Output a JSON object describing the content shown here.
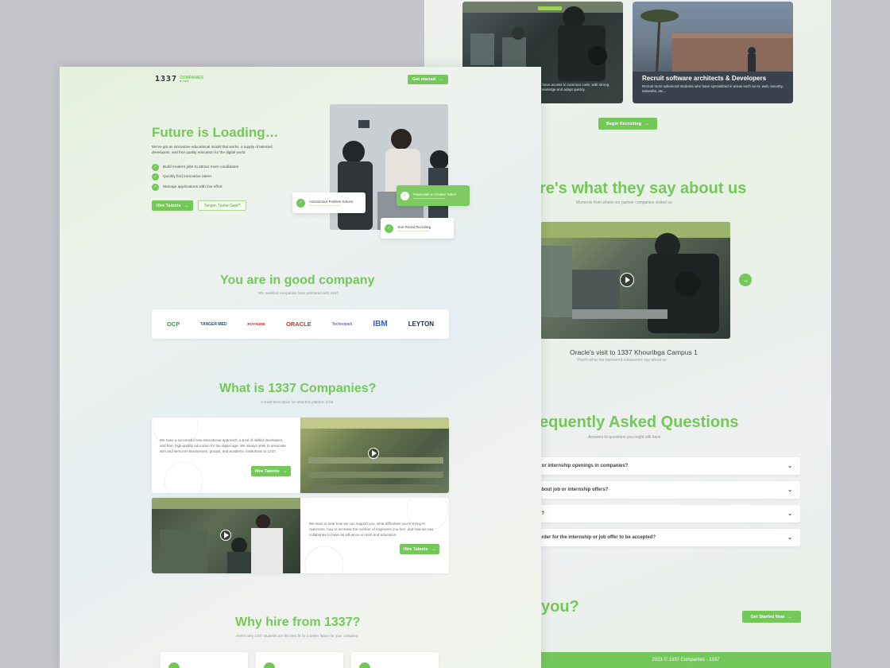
{
  "back": {
    "card_recruit_dev_sub": "…have access to common code, with strong knowledge and adapt quickly.",
    "card_recruit_arch_title": "Recruit software architects & Developers",
    "card_recruit_arch_sub": "Recruit more advanced students who have specialized in areas such as AI, web, security, networks, etc...",
    "begin_recruiting": "Begin Recruiting",
    "testimonials_title": "re's what they say about us",
    "testimonials_sub": "Moments from where our partner companies visited us",
    "video_caption": "Oracle's visit to 1337 Khouribga Campus 1",
    "video_sub": "Watch what our partnered companies say about us",
    "faq_title": "equently Asked Questions",
    "faq_sub": "Answers to questions you might still have",
    "faq_items": [
      "t or internship openings in companies?",
      "about job or internship offers?",
      "e?",
      "order for the internship or job offer to be accepted?"
    ],
    "cta_title": "you?",
    "get_started_now": "Get Started Now",
    "footer": "2023 © 1337 Companies - 1337"
  },
  "front": {
    "logo_num": "1337",
    "logo_top": "COMPANIES",
    "logo_bottom": "BY 1337",
    "get_started": "Get started",
    "hero_title": "Future is Loading…",
    "hero_desc": "We've got an innovative educational model that works, a supply of talented developers, and free quality education for the digital world.",
    "checklist": [
      "Build modern jobs to attract more candidates",
      "Quickly find innovative talent",
      "Manage applications with low effort"
    ],
    "hire_talents": "Hire Talents",
    "tanger": "Tanger, Tanke-Sept?",
    "float_autonomous": "Autonomous Problem Solvers",
    "float_passionate": "Passionate & Creative Talent",
    "float_recruiting": "Year-Round Recruiting",
    "good_company_title": "You are in good company",
    "good_company_sub": "50+ satisfied companies have partnered with 1337",
    "partners": [
      {
        "name": "OCP",
        "color": "#3d9a3a"
      },
      {
        "name": "TANGER MED",
        "color": "#1a4f8c"
      },
      {
        "name": "ROYAUME",
        "color": "#c32a2a"
      },
      {
        "name": "ORACLE",
        "color": "#d6302a"
      },
      {
        "name": "Technopark",
        "color": "#2d3f8f"
      },
      {
        "name": "IBM",
        "color": "#3560b8"
      },
      {
        "name": "LEYTON",
        "color": "#1e2b5c"
      }
    ],
    "what_title": "What is 1337 Companies?",
    "what_sub": "A small description for what this platform is for",
    "what_text_1": "We have a successful new educational approach, a pool of skilled developers, and free, high-quality education for the digital age. We always seek to associate with and welcome Businesses, groups, and academic institutions to 1337.",
    "what_text_2": "We want to hear how we can support you, what difficulties you're trying to overcome, how to increase the number of engineers you hire, and how we can collaborate to have an influence on tech and education.",
    "why_title": "Why hire from 1337?",
    "why_sub": "Here's why 1337 students are the best fit for a better future for your company"
  },
  "colors": {
    "accent": "#74c85a"
  }
}
